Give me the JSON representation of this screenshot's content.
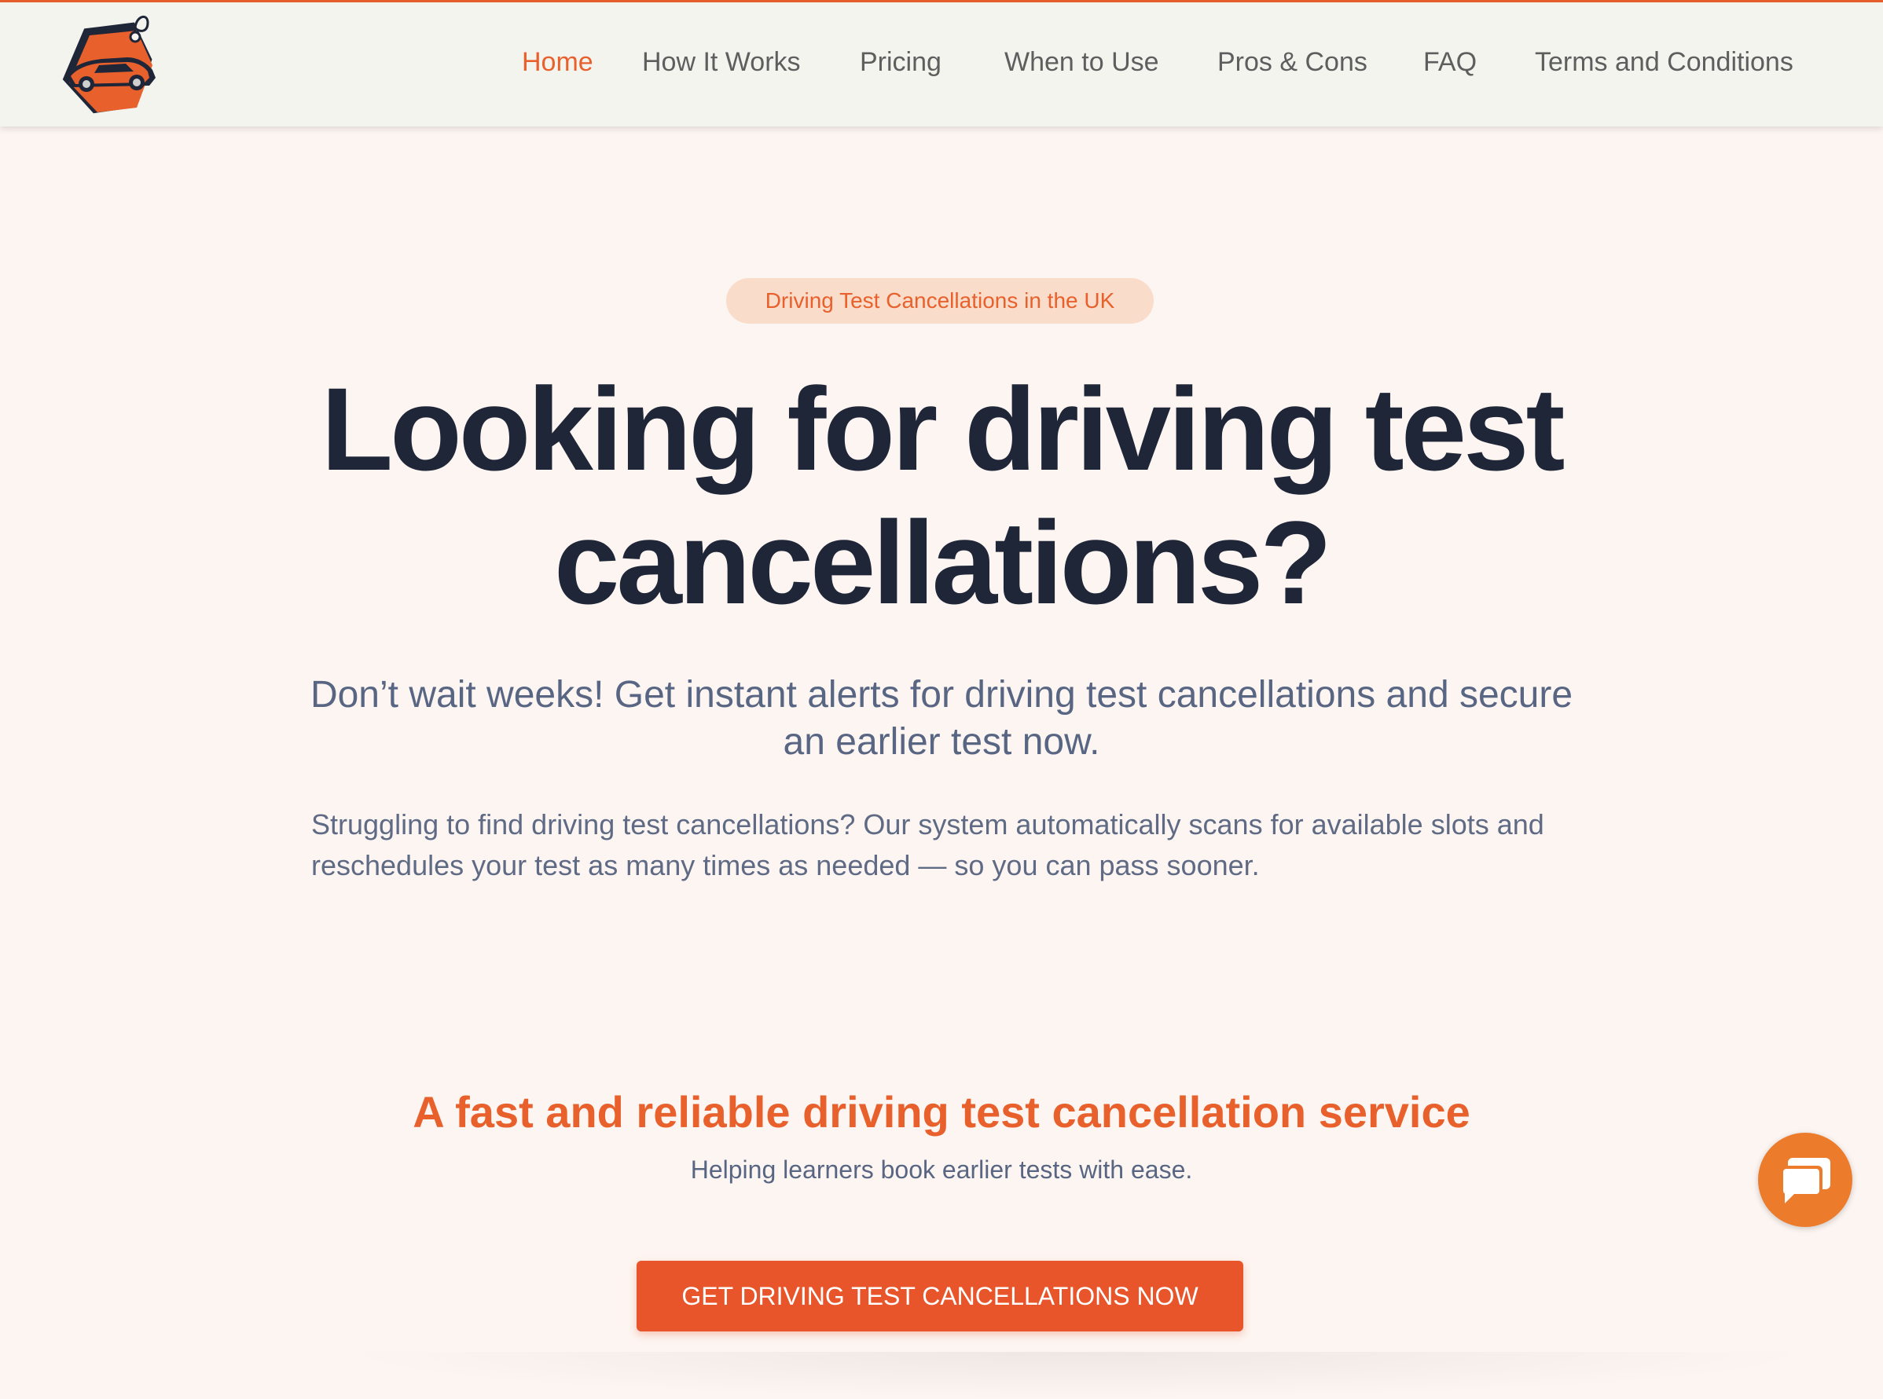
{
  "brand": {
    "logo_icon": "car-tag-logo-icon",
    "accent_color": "#e8602c"
  },
  "nav": {
    "items": [
      {
        "label": "Home",
        "active": true
      },
      {
        "label": "How It Works",
        "active": false
      },
      {
        "label": "Pricing",
        "active": false
      },
      {
        "label": "When to Use",
        "active": false
      },
      {
        "label": "Pros & Cons",
        "active": false
      },
      {
        "label": "FAQ",
        "active": false
      },
      {
        "label": "Terms and Conditions",
        "active": false
      }
    ]
  },
  "hero": {
    "badge": "Driving Test Cancellations in the UK",
    "headline_line1": "Looking for driving test",
    "headline_line2": "cancellations?",
    "subtitle": "Don’t wait weeks! Get instant alerts for driving test cancellations and secure an earlier test now.",
    "body": "Struggling to find driving test cancellations? Our system automatically scans for available slots and reschedules your test as many times as needed — so you can pass sooner.",
    "tagline": "A fast and reliable driving test cancellation service",
    "tagline_sub": "Helping learners book earlier tests with ease.",
    "cta_label": "GET DRIVING TEST CANCELLATIONS NOW"
  },
  "chat": {
    "icon": "chat-bubbles-icon",
    "color": "#ec7b2c"
  }
}
